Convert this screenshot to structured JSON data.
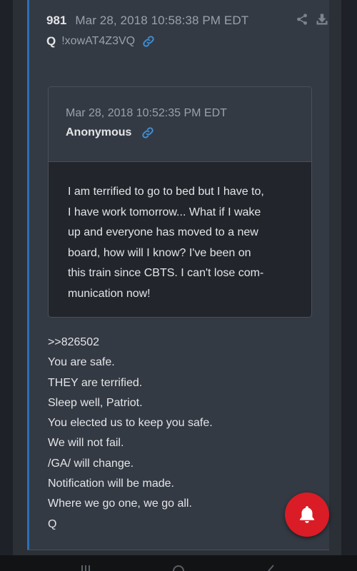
{
  "post": {
    "number": "981",
    "timestamp": "Mar 28, 2018 10:58:38 PM EDT",
    "name": "Q",
    "tripcode": "!xowAT4Z3VQ"
  },
  "quote": {
    "timestamp": "Mar 28, 2018 10:52:35 PM EDT",
    "author": "Anonymous",
    "lines": [
      "I am terrified to go to bed but I have to,",
      "I have work tomorrow... What if I wake",
      "up and everyone has moved to a new",
      "board,  how will I know?  I've been on",
      "this train since CBTS. I can't lose com-",
      "munication now!"
    ]
  },
  "reply": {
    "lines": [
      ">>826502",
      "You are safe.",
      "THEY are terrified.",
      "Sleep well, Patriot.",
      "You elected us to keep you safe.",
      "We will not fail.",
      "/GA/ will change.",
      "Notification will be made.",
      "Where we go one, we go all.",
      "Q"
    ]
  },
  "icons": {
    "share": "share-icon",
    "download": "download-icon",
    "link": "link-icon",
    "notification": "bell-icon"
  },
  "colors": {
    "background": "#2b2f36",
    "card": "#343a43",
    "quote_body": "#22262c",
    "accent": "#2c6fb8",
    "link": "#3f8fd8",
    "fab": "#d91c26",
    "text": "#e3e5e8",
    "muted": "#9aa1aa"
  }
}
